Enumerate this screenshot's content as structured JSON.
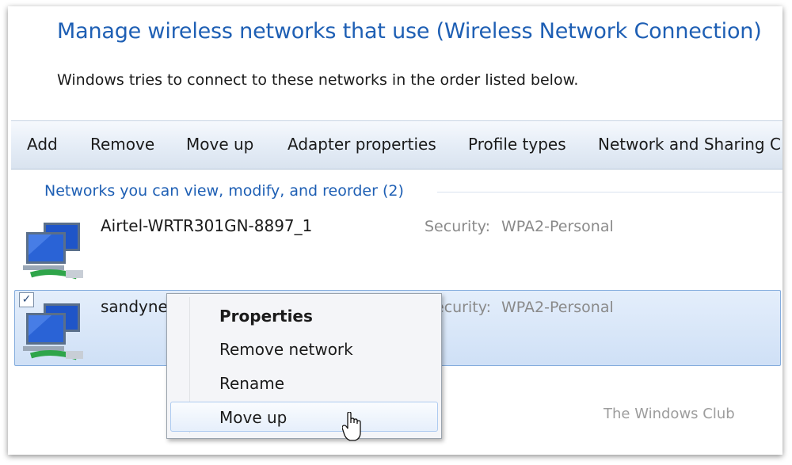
{
  "page": {
    "title": "Manage wireless networks that use (Wireless Network Connection)",
    "subtitle": "Windows tries to connect to these networks in the order listed below."
  },
  "toolbar": {
    "add": "Add",
    "remove": "Remove",
    "move_up": "Move up",
    "adapter_properties": "Adapter properties",
    "profile_types": "Profile types",
    "network_sharing": "Network and Sharing C"
  },
  "group": {
    "header": "Networks you can view, modify, and reorder (2)"
  },
  "networks": [
    {
      "name": "Airtel-WRTR301GN-8897_1",
      "security_label": "Security:",
      "security_value": "WPA2-Personal",
      "icon": "wireless-network-icon",
      "selected": false
    },
    {
      "name": "sandyne",
      "security_label": "ecurity:",
      "security_value": "WPA2-Personal",
      "icon": "wireless-network-icon",
      "selected": true,
      "checked": true
    }
  ],
  "context_menu": {
    "items": [
      {
        "label": "Properties",
        "bold": true
      },
      {
        "label": "Remove network",
        "bold": false
      },
      {
        "label": "Rename",
        "bold": false
      },
      {
        "label": "Move up",
        "bold": false,
        "hover": true
      }
    ]
  },
  "watermark": "The Windows Club",
  "colors": {
    "title_blue": "#1e5fb4",
    "selection_fill": "#cfe0f6",
    "selection_border": "#84acdd",
    "toolbar_bg": "#e4ecf6"
  },
  "icons": {
    "network": "wireless-network-icon",
    "checkbox": "checkbox-checked-icon",
    "cursor": "mouse-pointer-icon"
  }
}
